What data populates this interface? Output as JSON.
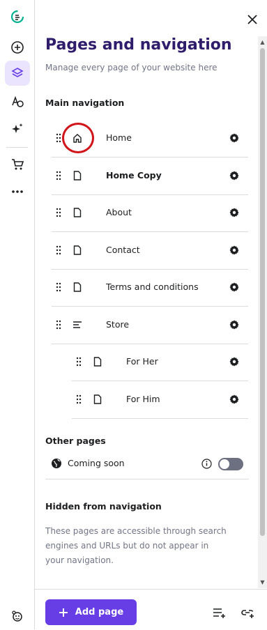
{
  "panel": {
    "title": "Pages and navigation",
    "subtitle": "Manage every page of your website here",
    "main_nav_heading": "Main navigation",
    "main_nav": [
      {
        "label": "Home",
        "icon": "home-icon",
        "bold": false
      },
      {
        "label": "Home Copy",
        "icon": "page-icon",
        "bold": true
      },
      {
        "label": "About",
        "icon": "page-icon",
        "bold": false
      },
      {
        "label": "Contact",
        "icon": "page-icon",
        "bold": false
      },
      {
        "label": "Terms and conditions",
        "icon": "page-icon",
        "bold": false
      },
      {
        "label": "Store",
        "icon": "store-lines-icon",
        "bold": false
      },
      {
        "label": "For Her",
        "icon": "page-icon",
        "bold": false
      },
      {
        "label": "For Him",
        "icon": "page-icon",
        "bold": false
      }
    ],
    "other_pages_heading": "Other pages",
    "other_pages": [
      {
        "label": "Coming soon",
        "icon": "globe-icon",
        "enabled": false
      }
    ],
    "hidden_heading": "Hidden from navigation",
    "hidden_description": "These pages are accessible through search engines and URLs but do not appear in your navigation.",
    "add_page_label": "Add page"
  },
  "colors": {
    "accent": "#673de6",
    "title": "#2f1c6a",
    "active_rail_bg": "#ebe4ff",
    "highlight": "#d1161b",
    "toggle_off": "#6d7081"
  }
}
